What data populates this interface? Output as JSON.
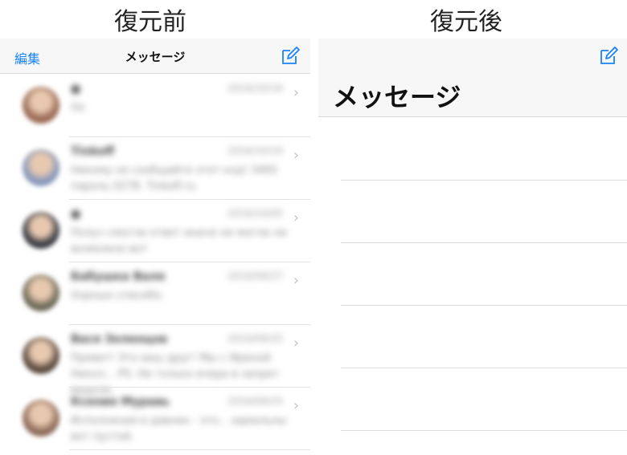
{
  "captions": {
    "before": "復元前",
    "after": "復元後"
  },
  "left_screen": {
    "nav": {
      "edit_label": "編集",
      "title": "メッセージ"
    },
    "conversations": [
      {
        "name": "●",
        "date": "2016/10/16",
        "preview": "Ок",
        "avatar_color": "#9a6a55"
      },
      {
        "name": "Tinkoff",
        "date": "2016/10/16",
        "preview": "Никому не сообщайте этот код! 3465 пароль 0278. Tinkoff.ru",
        "avatar_color": "#8899bb"
      },
      {
        "name": "●",
        "date": "2016/10/05",
        "preview": "Получ смогли ответ иначе не могли ли возможно вот",
        "avatar_color": "#3a3d44"
      },
      {
        "name": "Бабушка Валя",
        "date": "2016/09/27",
        "preview": "Хорошо спасибо.",
        "avatar_color": "#6d6a58"
      },
      {
        "name": "Вася Зеленцов",
        "date": "2016/09/25",
        "preview": "Привет! Это ваш друг! Мы с Ириной Никол... PS. Не только вчера в запрет видели.",
        "avatar_color": "#5b4a3e"
      },
      {
        "name": "Ксения Муравь",
        "date": "2016/09/25",
        "preview": "Исполнения в давних - это... идеальны вот пустой.",
        "avatar_color": "#8e6b5a"
      }
    ]
  },
  "right_screen": {
    "title": "メッセージ",
    "empty_rows": 5
  },
  "colors": {
    "accent": "#1a82fb",
    "nav_bg": "#f7f7f7",
    "divider": "#e2e2e2"
  },
  "icons": {
    "compose": "compose-icon",
    "chevron": "chevron-right-icon"
  }
}
